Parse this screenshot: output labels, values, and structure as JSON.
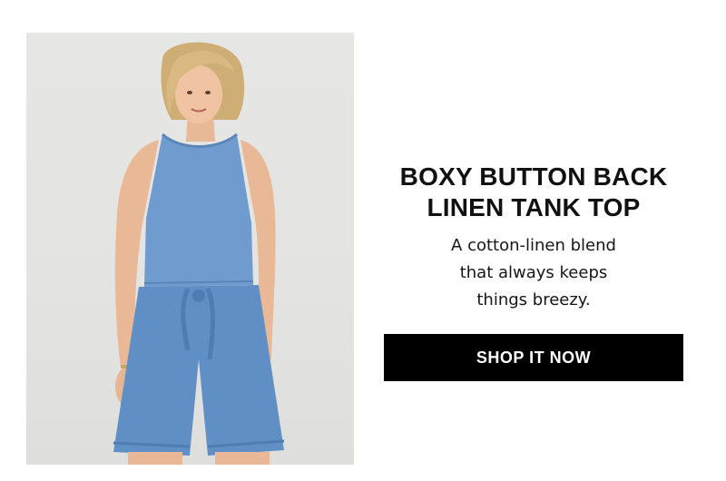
{
  "product_photo": {
    "subject": "model wearing chambray linen tank top and matching shorts",
    "background_color": "#e4e4e2",
    "denim_color": "#5f8fc4"
  },
  "promo": {
    "headline_line1": "BOXY BUTTON BACK",
    "headline_line2": "LINEN TANK TOP",
    "description_line1": "A cotton-linen blend",
    "description_line2": "that always keeps",
    "description_line3": "things breezy.",
    "cta_label": "SHOP IT NOW",
    "cta_color": "#000000",
    "cta_text_color": "#ffffff"
  }
}
